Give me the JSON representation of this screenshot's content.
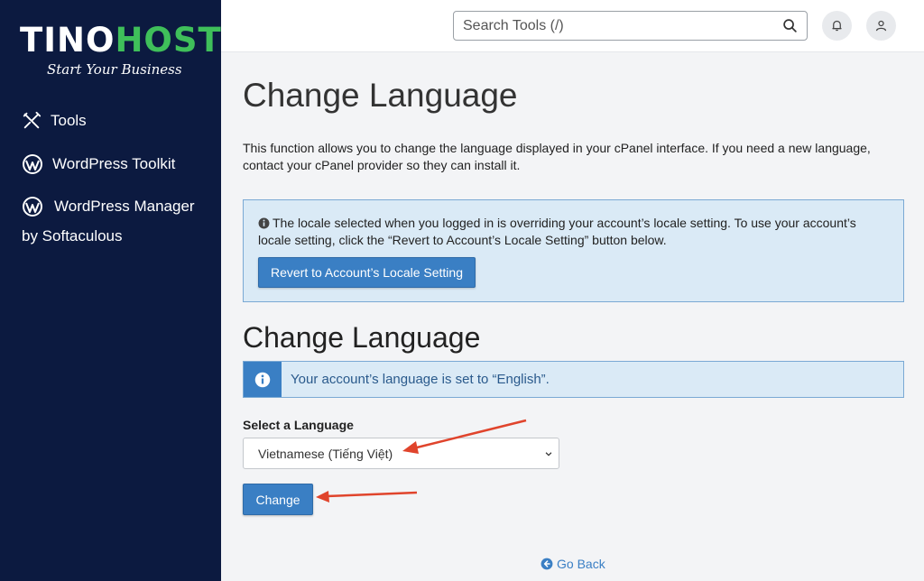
{
  "brand": {
    "name_part1": "TINO",
    "name_part2": "HOST",
    "tagline": "Start Your Business",
    "accent_color": "#3fbf5a"
  },
  "sidebar": {
    "background": "#0c1a40",
    "items": [
      {
        "label": "Tools",
        "icon": "tools-icon"
      },
      {
        "label": "WordPress Toolkit",
        "icon": "wordpress-icon"
      },
      {
        "label": "WordPress Manager",
        "label_line2": "by Softaculous",
        "icon": "wordpress-icon"
      }
    ]
  },
  "topbar": {
    "search_placeholder": "Search Tools (/)",
    "icons": [
      "search-icon",
      "bell-icon",
      "user-icon"
    ]
  },
  "main": {
    "title": "Change Language",
    "description": "This function allows you to change the language displayed in your cPanel interface. If you need a new language, contact your cPanel provider so they can install it.",
    "locale_alert": {
      "text": "The locale selected when you logged in is overriding your account’s locale setting. To use your account’s locale setting, click the “Revert to Account’s Locale Setting” button below.",
      "button_label": "Revert to Account’s Locale Setting"
    },
    "section_title": "Change Language",
    "info_text": "Your account’s language is set to “English”.",
    "select_label": "Select a Language",
    "selected_language": "Vietnamese (Tiếng Việt)",
    "change_button": "Change",
    "go_back": "Go Back"
  },
  "colors": {
    "primary_button": "#3a7fc4",
    "info_background": "#daeaf6",
    "annotation_arrow": "#e0442c"
  }
}
